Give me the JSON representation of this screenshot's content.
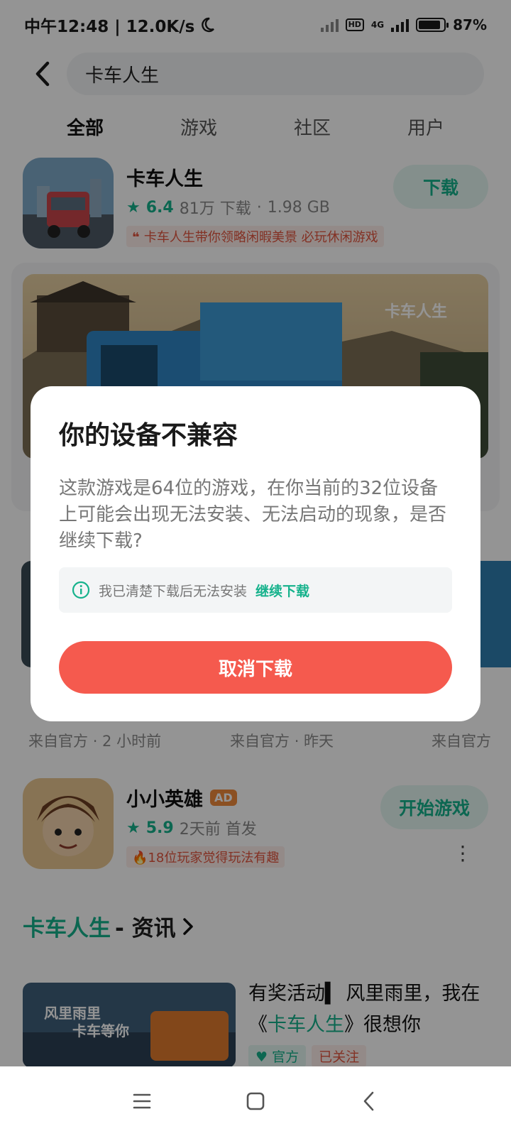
{
  "status_bar": {
    "time": "中午12:48 | 12.0K/s",
    "network": "4G",
    "hd": "HD",
    "battery": "87%",
    "battery_level": 0.87
  },
  "search": {
    "query": "卡车人生"
  },
  "tabs": [
    {
      "label": "全部",
      "active": true
    },
    {
      "label": "游戏",
      "active": false
    },
    {
      "label": "社区",
      "active": false
    },
    {
      "label": "用户",
      "active": false
    }
  ],
  "top_app": {
    "name": "卡车人生",
    "rating": "6.4",
    "downloads": "81万 下载",
    "size": "1.98 GB",
    "tagline": "卡车人生带你领略闲暇美景 必玩休闲游戏",
    "button": "下载"
  },
  "video_cards": [
    {
      "source": "来自官方",
      "time": "2 小时前"
    },
    {
      "source": "来自官方",
      "time": "昨天"
    },
    {
      "source": "来自官方",
      "time": ""
    }
  ],
  "ad_app": {
    "name": "小小英雄",
    "badge": "AD",
    "rating": "5.9",
    "meta": "2天前 首发",
    "tag": "18位玩家觉得玩法有趣",
    "button": "开始游戏"
  },
  "news_section": {
    "title_highlight": "卡车人生",
    "title_rest": "- 资讯",
    "article": {
      "title_pre": "有奖活动▍ 风里雨里，我在《",
      "title_highlight": "卡车人生",
      "title_post": "》很想你",
      "tag_official": "官方",
      "tag_followed": "已关注"
    }
  },
  "dialog": {
    "title": "你的设备不兼容",
    "body": "这款游戏是64位的游戏，在你当前的32位设备上可能会出现无法安装、无法启动的现象，是否继续下载?",
    "notice_text": "我已清楚下载后无法安装",
    "notice_link": "继续下载",
    "cancel_button": "取消下载"
  },
  "colors": {
    "accent_green": "#16b28c",
    "cancel_red": "#f55a4e"
  }
}
